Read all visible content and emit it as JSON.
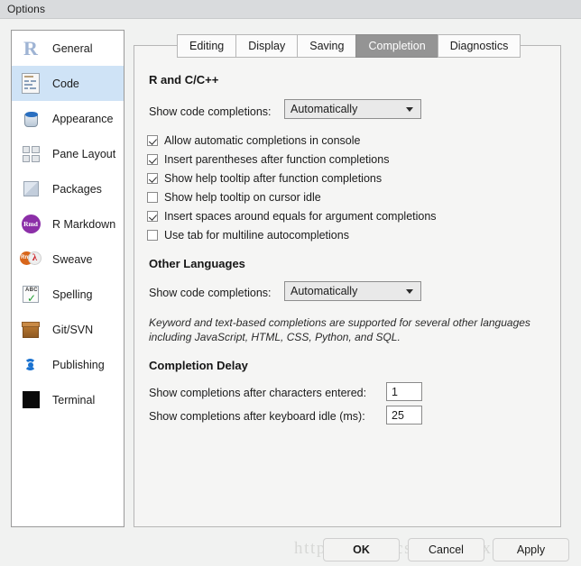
{
  "window": {
    "title": "Options"
  },
  "sidebar": {
    "items": [
      {
        "label": "General",
        "icon": "r-logo-icon",
        "selected": false
      },
      {
        "label": "Code",
        "icon": "code-file-icon",
        "selected": true
      },
      {
        "label": "Appearance",
        "icon": "paint-bucket-icon",
        "selected": false
      },
      {
        "label": "Pane Layout",
        "icon": "pane-grid-icon",
        "selected": false
      },
      {
        "label": "Packages",
        "icon": "package-box-icon",
        "selected": false
      },
      {
        "label": "R Markdown",
        "icon": "rmd-badge-icon",
        "selected": false
      },
      {
        "label": "Sweave",
        "icon": "sweave-rnw-pdf-icon",
        "selected": false
      },
      {
        "label": "Spelling",
        "icon": "spellcheck-icon",
        "selected": false
      },
      {
        "label": "Git/SVN",
        "icon": "git-box-icon",
        "selected": false
      },
      {
        "label": "Publishing",
        "icon": "publishing-icon",
        "selected": false
      },
      {
        "label": "Terminal",
        "icon": "terminal-icon",
        "selected": false
      }
    ]
  },
  "tabs": [
    {
      "label": "Editing",
      "active": false
    },
    {
      "label": "Display",
      "active": false
    },
    {
      "label": "Saving",
      "active": false
    },
    {
      "label": "Completion",
      "active": true
    },
    {
      "label": "Diagnostics",
      "active": false
    }
  ],
  "main": {
    "r_cpp": {
      "heading": "R and C/C++",
      "show_completions_label": "Show code completions:",
      "show_completions_value": "Automatically",
      "checkboxes": [
        {
          "label": "Allow automatic completions in console",
          "checked": true
        },
        {
          "label": "Insert parentheses after function completions",
          "checked": true
        },
        {
          "label": "Show help tooltip after function completions",
          "checked": true
        },
        {
          "label": "Show help tooltip on cursor idle",
          "checked": false
        },
        {
          "label": "Insert spaces around equals for argument completions",
          "checked": true
        },
        {
          "label": "Use tab for multiline autocompletions",
          "checked": false
        }
      ]
    },
    "other_languages": {
      "heading": "Other Languages",
      "show_completions_label": "Show code completions:",
      "show_completions_value": "Automatically",
      "help_text": "Keyword and text-based completions are supported for several other languages including JavaScript, HTML, CSS, Python, and SQL."
    },
    "completion_delay": {
      "heading": "Completion Delay",
      "chars_label": "Show completions after characters entered:",
      "chars_value": "1",
      "idle_label": "Show completions after keyboard idle (ms):",
      "idle_value": "25"
    }
  },
  "footer": {
    "ok_label": "OK",
    "cancel_label": "Cancel",
    "apply_label": "Apply"
  },
  "watermark": {
    "text": "https://blog.csdn.net/jixing11"
  },
  "colors": {
    "titlebar": "#d9dbdd",
    "dialog_bg": "#f1f2f1",
    "selection_blue": "#cfe3f6",
    "active_tab_gray": "#949494"
  }
}
